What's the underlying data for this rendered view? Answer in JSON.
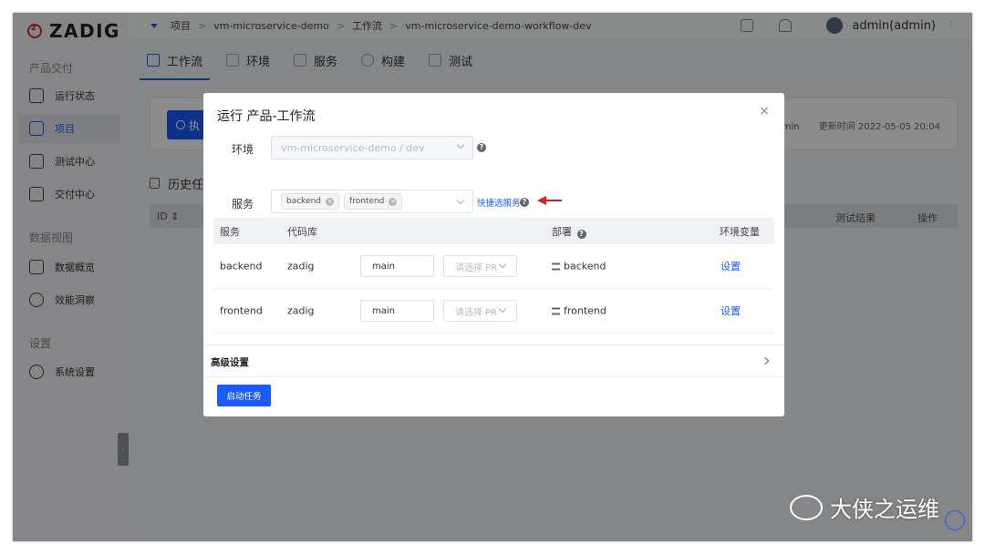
{
  "logo": {
    "text": "ZADIG"
  },
  "sidebar": {
    "section1": "产品交付",
    "items1": [
      {
        "label": "运行状态",
        "icon": "pulse-icon"
      },
      {
        "label": "项目",
        "icon": "project-icon"
      },
      {
        "label": "测试中心",
        "icon": "flask-icon"
      },
      {
        "label": "交付中心",
        "icon": "package-icon"
      }
    ],
    "section2": "数据视图",
    "items2": [
      {
        "label": "数据概览",
        "icon": "monitor-icon"
      },
      {
        "label": "效能洞察",
        "icon": "pie-icon"
      }
    ],
    "section3": "设置",
    "items3": [
      {
        "label": "系统设置",
        "icon": "gear-icon"
      }
    ],
    "collapse": "‹"
  },
  "breadcrumb": [
    "项目",
    ">",
    "vm-microservice-demo",
    ">",
    "工作流",
    ">",
    "vm-microservice-demo-workflow-dev"
  ],
  "topbar": {
    "username": "admin(admin)",
    "kebab": "⋮"
  },
  "tabs": [
    "工作流",
    "环境",
    "服务",
    "构建",
    "测试"
  ],
  "background": {
    "run_button": "执",
    "meta_user": "admin",
    "meta_update": "更新时间  2022-05-05 20:04",
    "history_title": "历史任务",
    "table_headers": {
      "id": "ID ⇕",
      "test_result": "测试结果",
      "action": "操作"
    }
  },
  "modal": {
    "title": "运行 产品-工作流",
    "close": "×",
    "env_label": "环境",
    "env_value": "vm-microservice-demo / dev",
    "service_label": "服务",
    "service_tags": [
      "backend",
      "frontend"
    ],
    "quick_link": "快捷选服务",
    "table": {
      "headers": [
        "服务",
        "代码库",
        "部署",
        "环境变量"
      ],
      "rows": [
        {
          "service": "backend",
          "repo": "zadig",
          "branch": "main",
          "pr_placeholder": "请选择 PR",
          "deploy": "backend",
          "env": "设置"
        },
        {
          "service": "frontend",
          "repo": "zadig",
          "branch": "main",
          "pr_placeholder": "请选择 PR",
          "deploy": "frontend",
          "env": "设置"
        }
      ]
    },
    "advanced": "高级设置",
    "start_button": "启动任务"
  },
  "watermark": "大侠之运维",
  "colors": {
    "accent": "#1a5aff",
    "brand_red": "#e1262d"
  }
}
